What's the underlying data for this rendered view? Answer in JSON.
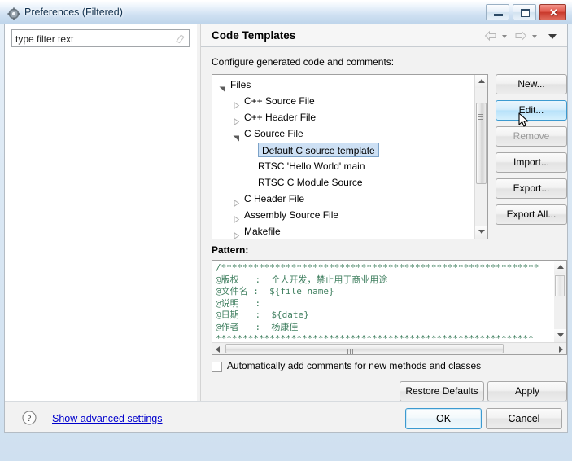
{
  "window": {
    "title": "Preferences (Filtered)",
    "icon": "preferences-gear-icon",
    "minimize_label": "",
    "maximize_label": "",
    "close_label": "✕"
  },
  "filter": {
    "value": "type filter text",
    "placeholder": "type filter text",
    "clear_icon": "erase-filter-icon"
  },
  "page": {
    "title": "Code Templates",
    "configure_label": "Configure generated code and comments:",
    "pattern_label": "Pattern:"
  },
  "nav": {
    "back_icon": "arrow-left-icon",
    "back_dropdown_icon": "chevron-down-icon",
    "forward_icon": "arrow-right-icon",
    "forward_dropdown_icon": "chevron-down-icon",
    "menu_icon": "chevron-down-icon"
  },
  "tree": {
    "items": [
      {
        "label": "Files",
        "indent": 0,
        "state": "expanded",
        "selected": false
      },
      {
        "label": "C++ Source File",
        "indent": 1,
        "state": "collapsed",
        "selected": false
      },
      {
        "label": "C++ Header File",
        "indent": 1,
        "state": "collapsed",
        "selected": false
      },
      {
        "label": "C Source File",
        "indent": 1,
        "state": "expanded",
        "selected": false
      },
      {
        "label": "Default C source template",
        "indent": 2,
        "state": "leaf",
        "selected": true
      },
      {
        "label": "RTSC 'Hello World' main",
        "indent": 2,
        "state": "leaf",
        "selected": false
      },
      {
        "label": "RTSC C Module Source",
        "indent": 2,
        "state": "leaf",
        "selected": false
      },
      {
        "label": "C Header File",
        "indent": 1,
        "state": "collapsed",
        "selected": false
      },
      {
        "label": "Assembly Source File",
        "indent": 1,
        "state": "collapsed",
        "selected": false
      },
      {
        "label": "Makefile",
        "indent": 1,
        "state": "collapsed",
        "selected": false
      }
    ],
    "scrollbar": {
      "up_icon": "scroll-up-icon",
      "down_icon": "scroll-down-icon"
    }
  },
  "side_buttons": [
    {
      "label": "New...",
      "enabled": true,
      "hover": false
    },
    {
      "label": "Edit...",
      "enabled": true,
      "hover": true
    },
    {
      "label": "Remove",
      "enabled": false,
      "hover": false
    },
    {
      "label": "Import...",
      "enabled": true,
      "hover": false
    },
    {
      "label": "Export...",
      "enabled": true,
      "hover": false
    },
    {
      "label": "Export All...",
      "enabled": true,
      "hover": false
    }
  ],
  "pattern": {
    "text": "/***********************************************************\n@版权   :  个人开发，禁止用于商业用途\n@文件名 :  ${file_name}\n@说明   :\n@日期   :  ${date}\n@作者   :  杨康佳\n***********************************************************"
  },
  "options": {
    "auto_comment_label": "Automatically add comments for new methods and classes",
    "auto_comment_checked": false
  },
  "lower_buttons": {
    "restore_defaults": "Restore Defaults",
    "apply": "Apply"
  },
  "bottom": {
    "help_icon": "question-mark-icon",
    "advanced_link": "Show advanced settings",
    "ok": "OK",
    "cancel": "Cancel"
  },
  "colors": {
    "selection_fill": "#cde0f4",
    "selection_border": "#7ca2c8",
    "hover_button": "#b8e2fa",
    "link": "#0000cc",
    "pattern_text": "#3f7f5f",
    "close_button": "#c9392c"
  }
}
